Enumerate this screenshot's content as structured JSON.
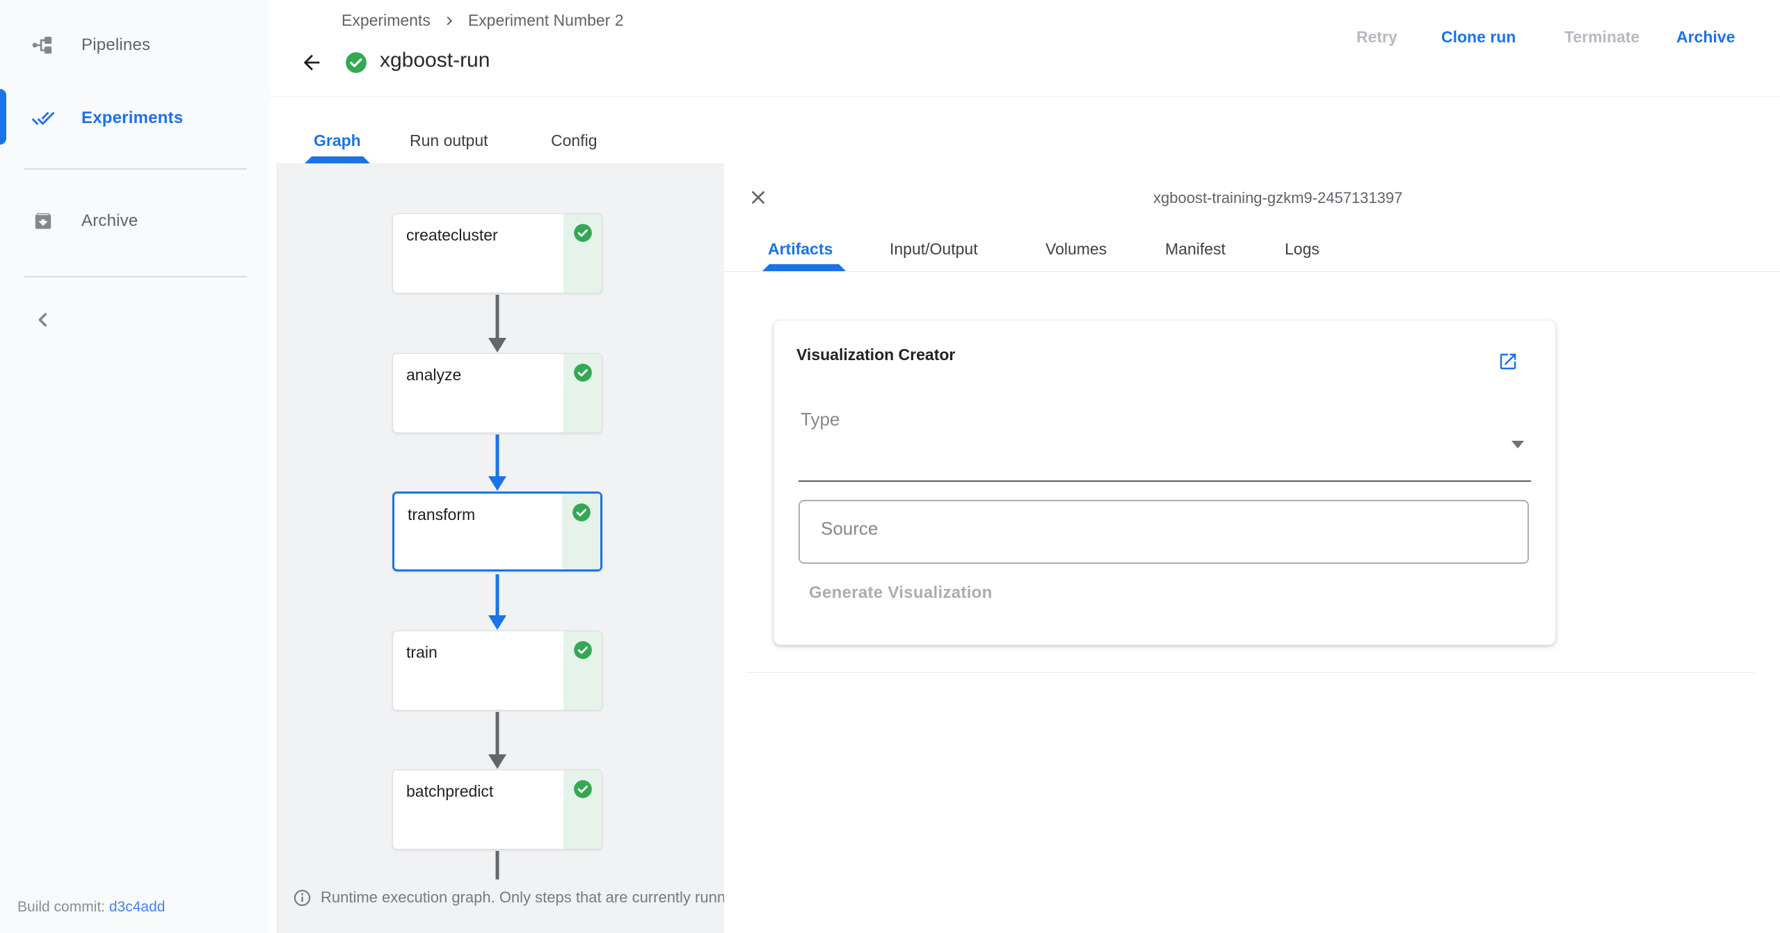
{
  "sidebar": {
    "items": [
      {
        "label": "Pipelines",
        "icon": "pipelines-icon",
        "active": false
      },
      {
        "label": "Experiments",
        "icon": "experiments-double-check-icon",
        "active": true
      },
      {
        "label": "Archive",
        "icon": "archive-box-icon",
        "active": false
      }
    ],
    "collapse_icon": "chevron-left",
    "build_commit": {
      "label": "Build commit:",
      "value": "d3c4add"
    }
  },
  "header": {
    "breadcrumb": {
      "parent": "Experiments",
      "separator_icon": "chevron-right",
      "current": "Experiment Number 2"
    },
    "back_icon": "arrow-left",
    "status_icon": "check-circle-green",
    "title": "xgboost-run",
    "actions": [
      {
        "label": "Retry",
        "enabled": false
      },
      {
        "label": "Clone run",
        "enabled": true
      },
      {
        "label": "Terminate",
        "enabled": false
      },
      {
        "label": "Archive",
        "enabled": true
      }
    ]
  },
  "run_tabs": [
    {
      "label": "Graph",
      "active": true
    },
    {
      "label": "Run output",
      "active": false
    },
    {
      "label": "Config",
      "active": false
    }
  ],
  "graph": {
    "nodes": [
      {
        "label": "createcluster",
        "status": "succeeded",
        "selected": false
      },
      {
        "label": "analyze",
        "status": "succeeded",
        "selected": false
      },
      {
        "label": "transform",
        "status": "succeeded",
        "selected": true
      },
      {
        "label": "train",
        "status": "succeeded",
        "selected": false
      },
      {
        "label": "batchpredict",
        "status": "succeeded",
        "selected": false
      }
    ],
    "footer_note": "Runtime execution graph. Only steps that are currently runni"
  },
  "detail_panel": {
    "close_icon": "close-x",
    "title": "xgboost-training-gzkm9-2457131397",
    "tabs": [
      {
        "label": "Artifacts",
        "active": true
      },
      {
        "label": "Input/Output",
        "active": false
      },
      {
        "label": "Volumes",
        "active": false
      },
      {
        "label": "Manifest",
        "active": false
      },
      {
        "label": "Logs",
        "active": false
      }
    ],
    "visualization_creator": {
      "title": "Visualization Creator",
      "open_icon": "open-in-new",
      "type_label": "Type",
      "source_placeholder": "Source",
      "generate_label": "Generate Visualization"
    }
  },
  "colors": {
    "accent_blue": "#1a73e8",
    "link_blue": "#4285f4",
    "success_green": "#34a853",
    "success_light_green": "#e6f3ea",
    "text_dark": "#202124",
    "text_grey": "#5f6368",
    "disabled_grey": "#b6babf",
    "graph_background": "#f1f2f3",
    "sidebar_background": "#f9fafb"
  }
}
